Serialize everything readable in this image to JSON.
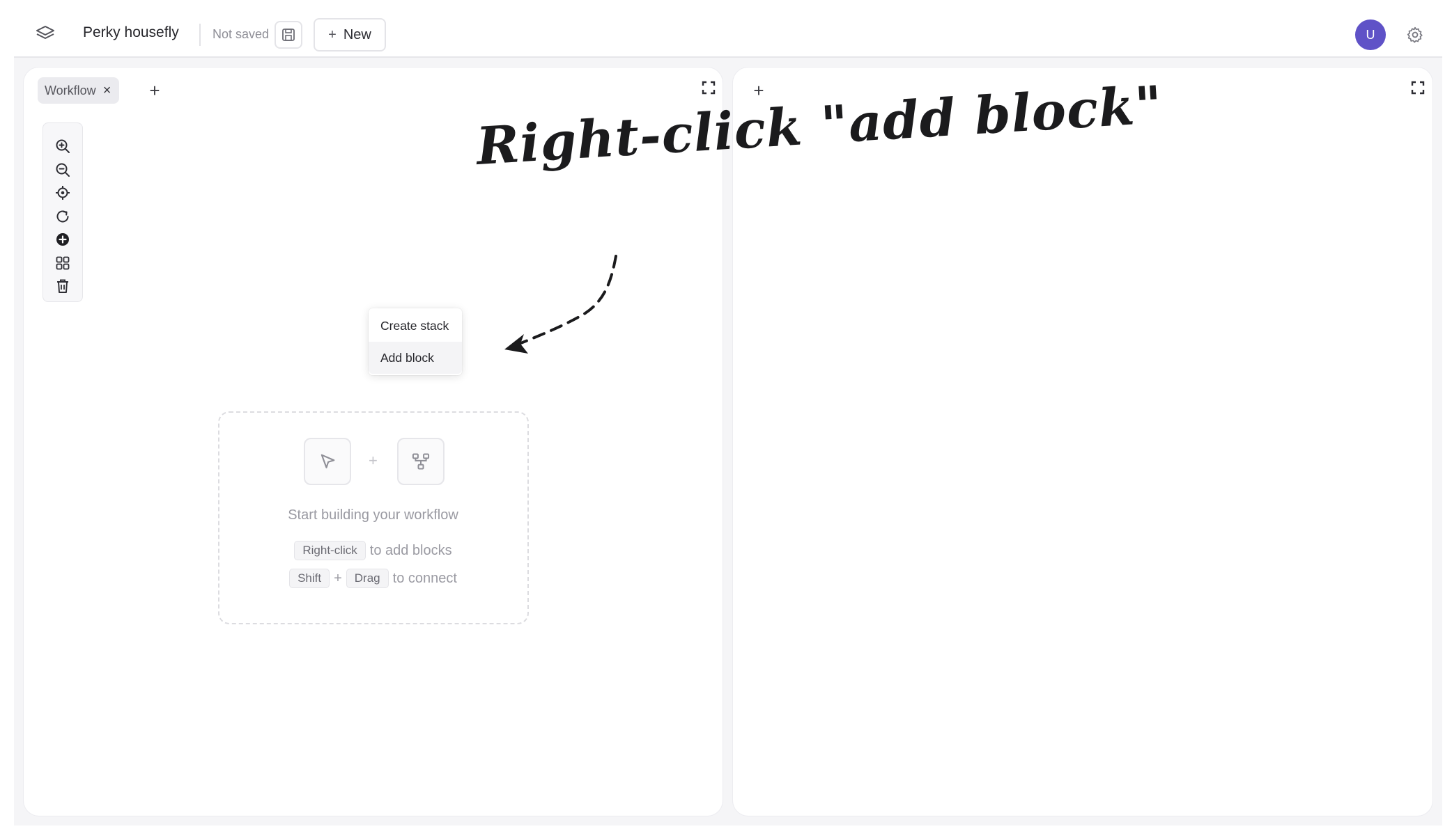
{
  "header": {
    "project_name": "Perky housefly",
    "save_status": "Not saved",
    "new_button_label": "New",
    "avatar_initial": "U"
  },
  "left_panel": {
    "tabs": [
      {
        "label": "Workflow"
      }
    ]
  },
  "toolbar": {
    "tools": [
      {
        "icon": "zoom-in-icon"
      },
      {
        "icon": "zoom-out-icon"
      },
      {
        "icon": "locate-icon"
      },
      {
        "icon": "refresh-icon"
      },
      {
        "icon": "add-circle-icon"
      },
      {
        "icon": "grid-icon"
      },
      {
        "icon": "trash-icon"
      }
    ]
  },
  "context_menu": {
    "items": [
      {
        "label": "Create stack"
      },
      {
        "label": "Add block"
      }
    ]
  },
  "empty_state": {
    "title": "Start building your workflow",
    "hint1_key": "Right-click",
    "hint1_text": "to add blocks",
    "hint2_key1": "Shift",
    "hint2_plus": "+",
    "hint2_key2": "Drag",
    "hint2_text": "to connect"
  },
  "annotation": {
    "text": "Right-click \"add block\""
  },
  "colors": {
    "avatar": "#5f52c7",
    "panel_background": "#ffffff",
    "app_background": "#f5f5f7"
  }
}
